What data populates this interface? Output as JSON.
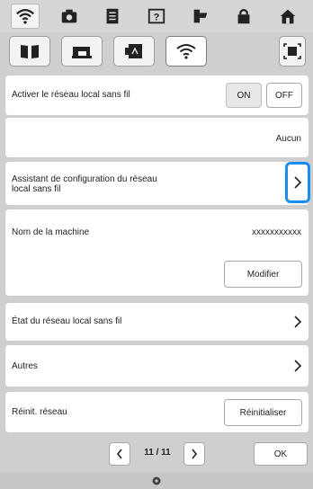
{
  "topbar": {
    "icons": [
      "wifi-icon",
      "camera-icon",
      "document-icon",
      "help-icon",
      "thread-icon",
      "lock-icon",
      "home-icon"
    ]
  },
  "subtabs": {
    "icons": [
      "book-icon",
      "sewing-machine-icon",
      "card-icon",
      "wifi-icon",
      "fullscreen-icon"
    ]
  },
  "rows": {
    "wlan_enable": {
      "label": "Activer le réseau local sans fil",
      "on": "ON",
      "off": "OFF"
    },
    "ssid": {
      "value": "Aucun"
    },
    "wizard": {
      "label_line1": "Assistant de configuration du réseau",
      "label_line2": "local sans fil"
    },
    "machine_name": {
      "label": "Nom de la machine",
      "value": "xxxxxxxxxxx",
      "button": "Modifier"
    },
    "wlan_status": {
      "label": "État du réseau local sans fil"
    },
    "others": {
      "label": "Autres"
    },
    "reset": {
      "label": "Réinit. réseau",
      "button": "Réinitialiser"
    }
  },
  "pager": {
    "page": "11 / 11",
    "ok": "OK"
  },
  "colors": {
    "highlight": "#1a8ef0",
    "panel": "#cfcfcf"
  }
}
